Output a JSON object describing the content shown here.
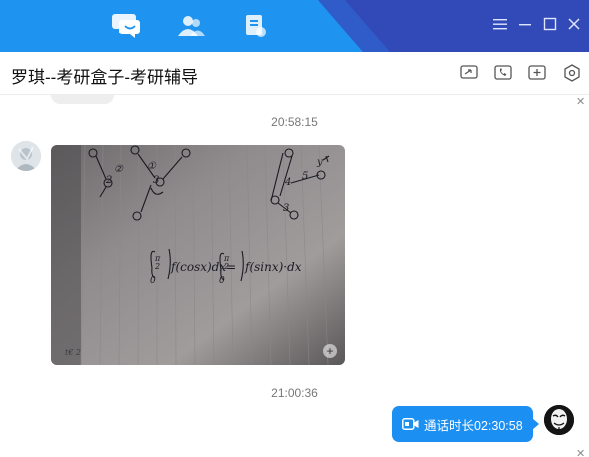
{
  "colors": {
    "topbar": "#1f93f0",
    "topbar_dark": "#3249b8",
    "bubble_blue": "#1b8ff2"
  },
  "nav_tabs": [
    {
      "name": "messages",
      "icon": "chat-bubble-icon",
      "active": true
    },
    {
      "name": "contacts",
      "icon": "contacts-icon",
      "active": false
    },
    {
      "name": "documents",
      "icon": "document-icon",
      "active": false
    }
  ],
  "window_controls": [
    "menu-icon",
    "minimize-icon",
    "maximize-icon",
    "close-icon"
  ],
  "conversation": {
    "title": "罗琪--考研盒子-考研辅导",
    "actions": [
      "screen-share-icon",
      "phone-call-icon",
      "add-icon",
      "settings-hexagon-icon"
    ]
  },
  "messages": [
    {
      "type": "timestamp",
      "text": "20:58:15"
    },
    {
      "type": "image",
      "sender": "contact",
      "description_icon": "handwritten-math-photo"
    },
    {
      "type": "timestamp",
      "text": "21:00:36"
    },
    {
      "type": "call",
      "sender": "me",
      "text": "通话时长02:30:58"
    }
  ],
  "photo_text": {
    "integral": "∫₀^{π/2} f(cosx)dx = ∫₀^{π/2} f(sinx)dx",
    "labels": [
      "②",
      "①",
      "③",
      "②",
      "②",
      "③",
      "④",
      "⑤",
      "③",
      "②",
      "③",
      "⑤",
      "2",
      "3",
      "4",
      "5",
      "y"
    ]
  }
}
